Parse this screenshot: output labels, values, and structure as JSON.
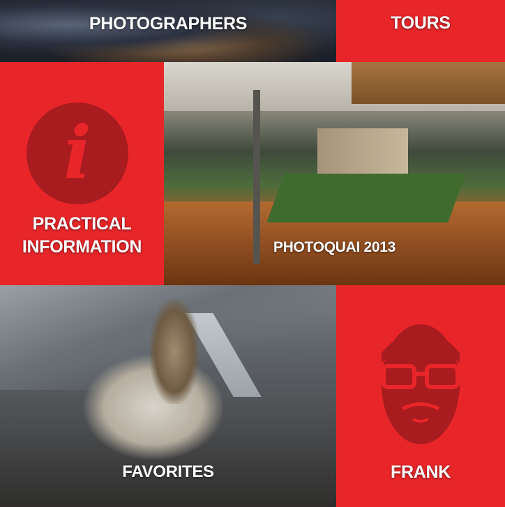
{
  "tiles": {
    "photographers": {
      "label": "PHOTOGRAPHERS"
    },
    "tours": {
      "label": "TOURS"
    },
    "practical_information": {
      "label_line1": "PRACTICAL",
      "label_line2": "INFORMATION",
      "icon": "info-icon"
    },
    "photoquai": {
      "label": "PHOTOQUAI 2013"
    },
    "favorites": {
      "label": "FAVORITES"
    },
    "frank": {
      "label": "FRANK",
      "icon": "face-glasses-beard-icon"
    }
  },
  "colors": {
    "accent_red": "#e8262a",
    "dark_red": "#a81b1e",
    "text": "#ffffff"
  }
}
